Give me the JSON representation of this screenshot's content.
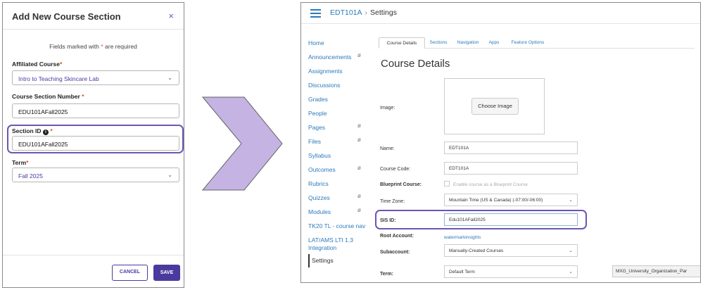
{
  "modal": {
    "title": "Add New Course Section",
    "close_glyph": "×",
    "required_note_prefix": "Fields marked with ",
    "required_star": "*",
    "required_note_suffix": " are required",
    "fields": {
      "affiliated_course": {
        "label": "Affiliated Course",
        "value": "Intro to Teaching Skincare Lab"
      },
      "section_number": {
        "label": "Course Section Number ",
        "value": "EDU101AFall2025"
      },
      "section_id": {
        "label": "Section ID ",
        "info_glyph": "i",
        "value": "EDU101AFall2025"
      },
      "term": {
        "label": "Term",
        "value": "Fall 2025"
      }
    },
    "cancel_label": "CANCEL",
    "save_label": "SAVE"
  },
  "canvas": {
    "breadcrumb": {
      "course": "EDT101A",
      "separator": "›",
      "current": "Settings"
    },
    "nav": [
      "Home",
      "Announcements",
      "Assignments",
      "Discussions",
      "Grades",
      "People",
      "Pages",
      "Files",
      "Syllabus",
      "Outcomes",
      "Rubrics",
      "Quizzes",
      "Modules",
      "TK20 TL - course nav",
      "LAT/AMS LTI 1.3",
      "Integration",
      "Settings"
    ],
    "tabs": [
      "Course Details",
      "Sections",
      "Navigation",
      "Apps",
      "Feature Options"
    ],
    "page_title": "Course Details",
    "labels": {
      "image": "Image:",
      "name": "Name:",
      "course_code": "Course Code:",
      "blueprint": "Blueprint Course:",
      "time_zone": "Time Zone:",
      "sis_id": "SIS ID:",
      "root_account": "Root Account:",
      "subaccount": "Subaccount:",
      "term": "Term:"
    },
    "values": {
      "choose_image": "Choose Image",
      "name": "EDT101A",
      "course_code": "EDT101A",
      "blueprint_text": "Enable course as a Blueprint Course",
      "time_zone": "Mountain Time (US & Canada) (-07:00/-06:00)",
      "sis_id": "Edu101AFall2025",
      "root_account": "watermarkinsights",
      "subaccount": "Manually-Created Courses",
      "term": "Default Term"
    },
    "tooltip": "MXG_University_Organization_Par"
  },
  "colors": {
    "accent": "#4b3a9e",
    "highlight": "#6c55b5",
    "link": "#2b7abc",
    "arrow": "#c4b3e3",
    "required": "#e0462f"
  }
}
